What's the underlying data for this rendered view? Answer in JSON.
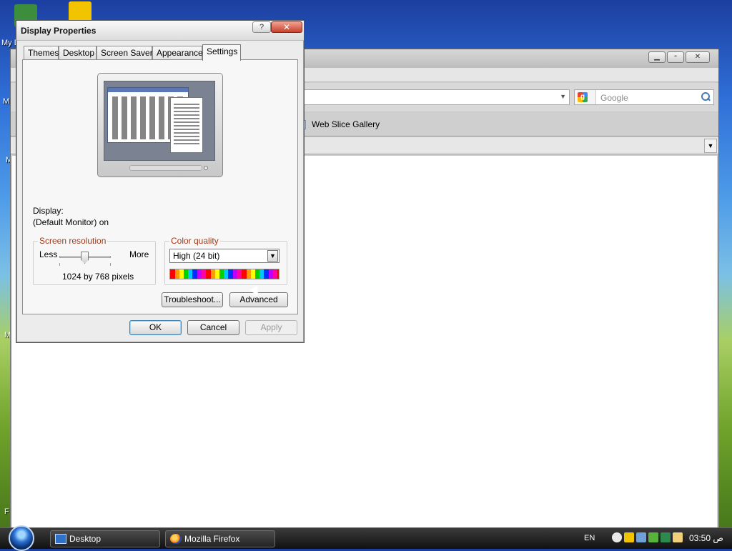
{
  "desktop": {
    "icon_labels": [
      "My D",
      "M",
      "M",
      "M",
      "F"
    ]
  },
  "browser": {
    "title_buttons": {
      "minimize": "▁",
      "restore": "▫",
      "close": "✕"
    },
    "search_placeholder": "Google",
    "bookmark_item": "Web Slice Gallery"
  },
  "dialog": {
    "title": "Display Properties",
    "help_label": "?",
    "close_label": "✕",
    "tabs": [
      "Themes",
      "Desktop",
      "Screen Saver",
      "Appearance",
      "Settings"
    ],
    "active_tab": "Settings",
    "display_label": "Display:",
    "display_value": "(Default Monitor) on",
    "screen_resolution": {
      "title": "Screen resolution",
      "less": "Less",
      "more": "More",
      "value": "1024 by 768 pixels",
      "slider_level": 0.42
    },
    "color_quality": {
      "title": "Color quality",
      "selected": "High (24 bit)"
    },
    "buttons": {
      "troubleshoot": "Troubleshoot...",
      "advanced": "Advanced",
      "ok": "OK",
      "cancel": "Cancel",
      "apply": "Apply"
    }
  },
  "taskbar": {
    "items": [
      "Desktop",
      "Mozilla Firefox"
    ],
    "language": "EN",
    "clock": "03:50 ص"
  },
  "colors": {
    "group_title": "#a33a1a",
    "close_button": "#c6422c",
    "default_button_border": "#3c7fb1"
  },
  "icons": [
    "search-icon",
    "google-icon",
    "firefox-icon",
    "desktop-icon",
    "start-orb-icon",
    "dropdown-arrow-icon",
    "help-icon",
    "close-icon"
  ]
}
